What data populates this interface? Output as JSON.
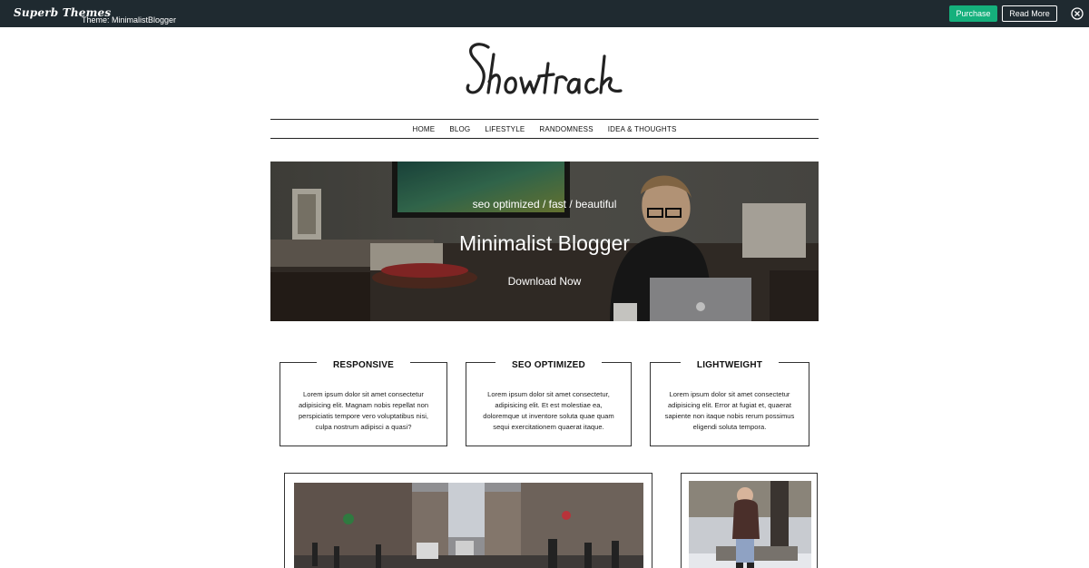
{
  "topbar": {
    "brand": "Superb Themes",
    "theme_label": "Theme: MinimalistBlogger",
    "purchase_label": "Purchase",
    "read_more_label": "Read More"
  },
  "logo": {
    "text": "Showtrack"
  },
  "nav": {
    "items": [
      "HOME",
      "BLOG",
      "LIFESTYLE",
      "RANDOMNESS",
      "IDEA & THOUGHTS"
    ]
  },
  "hero": {
    "subtitle": "seo optimized / fast / beautiful",
    "title": "Minimalist Blogger",
    "cta": "Download Now"
  },
  "features": [
    {
      "title": "RESPONSIVE",
      "text": "Lorem ipsum dolor sit amet consectetur adipisicing elit. Magnam nobis repellat non perspiciatis tempore vero voluptatibus nisi, culpa nostrum adipisci a quasi?"
    },
    {
      "title": "SEO OPTIMIZED",
      "text": "Lorem ipsum dolor sit amet consectetur, adipisicing elit. Et est molestiae ea, doloremque ut inventore soluta quae quam sequi exercitationem quaerat itaque."
    },
    {
      "title": "LIGHTWEIGHT",
      "text": "Lorem ipsum dolor sit amet consectetur adipisicing elit. Error at fugiat et, quaerat sapiente non itaque nobis rerum possimus eligendi soluta tempora."
    }
  ],
  "colors": {
    "topbar_bg": "#1f2a30",
    "purchase_bg": "#15b07c"
  }
}
